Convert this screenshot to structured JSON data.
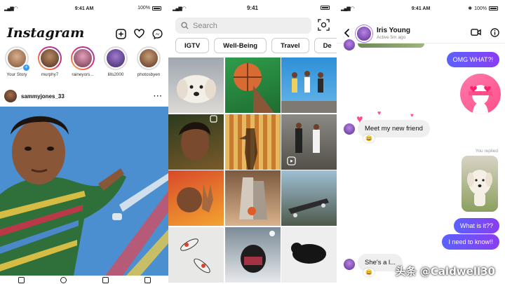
{
  "panel1": {
    "status": {
      "time": "9:41 AM",
      "battery": "100%"
    },
    "logo": "Instagram",
    "header_icons": [
      "add-icon",
      "heart-icon",
      "messenger-icon"
    ],
    "stories": [
      {
        "name": "Your Story"
      },
      {
        "name": "murphy7"
      },
      {
        "name": "raineyors..."
      },
      {
        "name": "lills2000"
      },
      {
        "name": "photosbyen"
      }
    ],
    "post": {
      "username": "sammyjones_33",
      "more": "···"
    }
  },
  "panel2": {
    "status": {
      "time": "9:41"
    },
    "search_placeholder": "Search",
    "chips": [
      "IGTV",
      "Well-Being",
      "Travel",
      "De"
    ]
  },
  "panel3": {
    "status": {
      "time": "9:41 AM",
      "battery": "100%"
    },
    "chat": {
      "name": "Iris Young",
      "status": "Active 5m ago"
    },
    "messages": {
      "omg": "OMG WHAT?!",
      "meet": "Meet my new friend",
      "you_replied": "You replied",
      "what_is_it": "What is it??",
      "need_to_know": "I need to know!!",
      "shes": "She's a l..."
    }
  },
  "watermark": "头条 @Caldwell30",
  "colors": {
    "accent_purple": "#6d55f5",
    "heart_pink": "#ff4f8b"
  }
}
